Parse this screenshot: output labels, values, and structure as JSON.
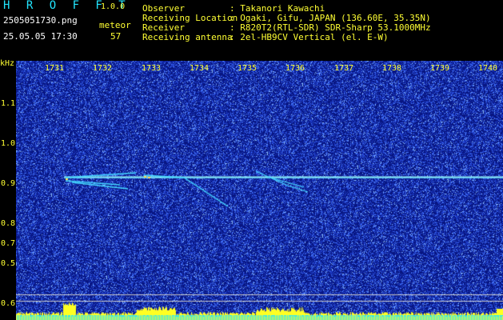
{
  "header": {
    "title": "H R O F F T",
    "version": "1.0.0",
    "file": "2505051730.png",
    "meteor_label": "meteor",
    "datetime": "25.05.05 17:30",
    "meteor_count": "57",
    "info": [
      {
        "label": "Observer",
        "value": ": Takanori Kawachi"
      },
      {
        "label": "Receiving Location",
        "value": ": Ogaki, Gifu, JAPAN (136.60E, 35.35N)"
      },
      {
        "label": "Receiver",
        "value": ": R820T2(RTL-SDR) SDR-Sharp 53.1000MHz"
      },
      {
        "label": "Receiving antenna",
        "value": ": 2el-HB9CV Vertical (el. E-W)"
      }
    ]
  },
  "chart_data": {
    "type": "heatmap",
    "ylabel": "kHz",
    "x_ticks": [
      "1731",
      "1732",
      "1733",
      "1734",
      "1735",
      "1736",
      "1737",
      "1738",
      "1739",
      "1740"
    ],
    "y_ticks": [
      "1.1",
      "1.0",
      "0.9",
      "0.8",
      "0.7",
      "0.6",
      "0.5"
    ],
    "y_ticks_lower": [
      "0.6"
    ],
    "carrier_khz": 0.91,
    "colors": {
      "background": "#0a1a7a",
      "noise": "#4a7aff",
      "trace": "#5fe9ff",
      "level": "#ffff22"
    }
  }
}
